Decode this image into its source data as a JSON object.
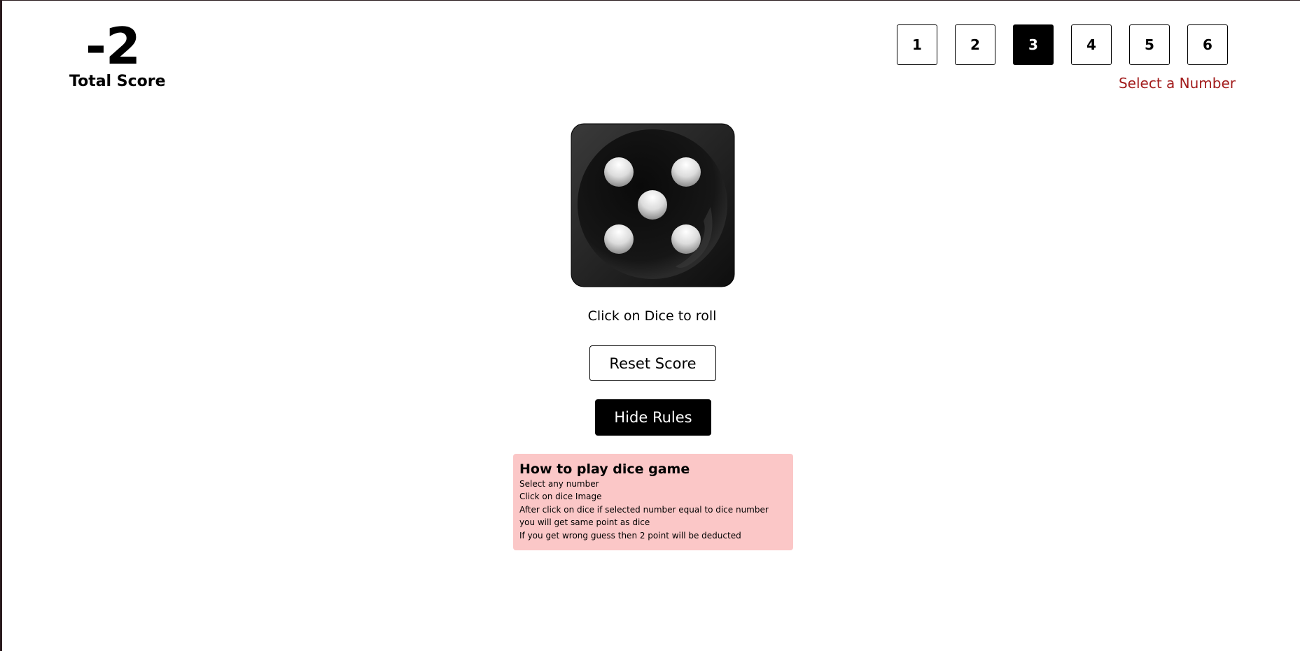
{
  "score": {
    "value": "-2",
    "label": "Total Score"
  },
  "numbers": {
    "options": [
      "1",
      "2",
      "3",
      "4",
      "5",
      "6"
    ],
    "selected": "3",
    "message": "Select a Number"
  },
  "dice": {
    "face": 5,
    "icon": "dice-five-icon"
  },
  "hint": "Click on Dice to roll",
  "buttons": {
    "reset_label": "Reset Score",
    "rules_label": "Hide Rules"
  },
  "rules": {
    "title": "How to play dice game",
    "lines": [
      "Select any number",
      "Click on dice Image",
      "After click on dice if selected number equal to dice number",
      "you will get same point as dice",
      "If you get wrong guess then 2 point will be deducted"
    ]
  },
  "colors": {
    "message": "#a21b1b",
    "rules_background": "#fbc7c7",
    "selected_box": "#000000"
  }
}
